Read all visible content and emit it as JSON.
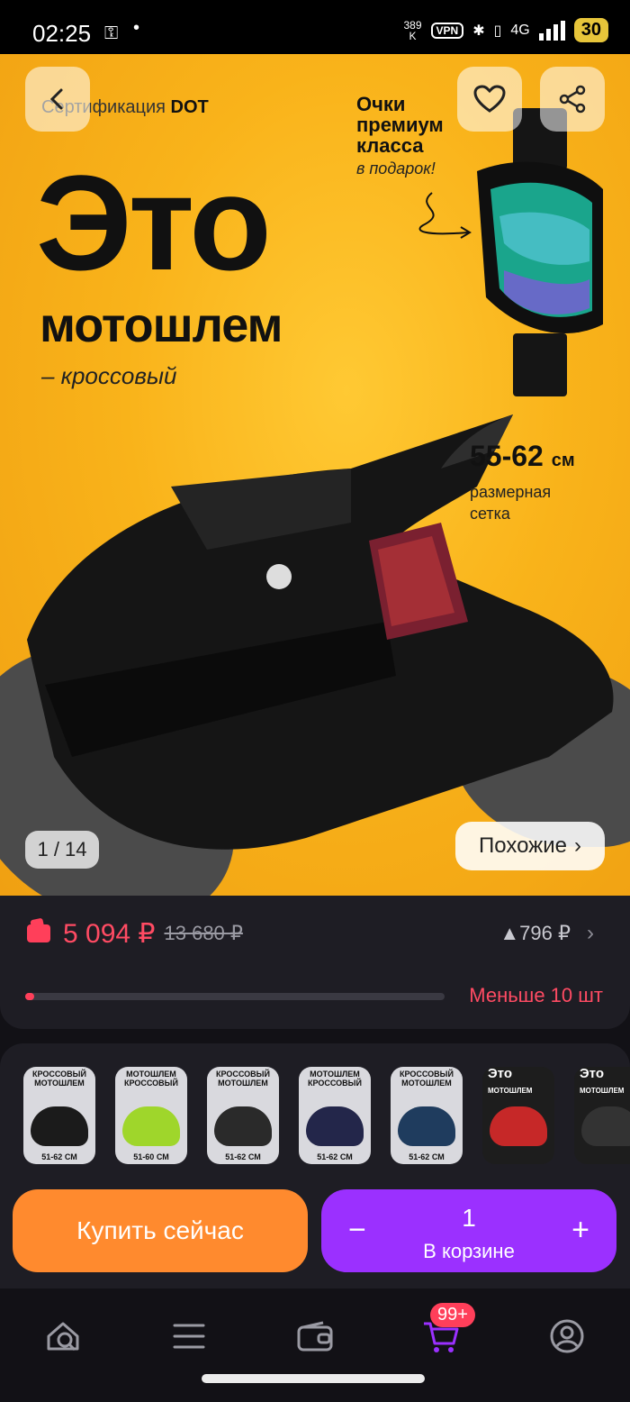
{
  "status_bar": {
    "time": "02:25",
    "speed_value": "389",
    "speed_unit": "K",
    "vpn": "VPN",
    "network": "4G",
    "battery": "30"
  },
  "hero": {
    "certification_prefix": "Сертификация",
    "certification_brand": "DOT",
    "headline_big": "Это",
    "headline_sub": "мотошлем",
    "headline_type": "– кроссовый",
    "goggles_title_1": "Очки",
    "goggles_title_2": "премиум",
    "goggles_title_3": "класса",
    "goggles_subtitle": "в подарок!",
    "size_value": "55-62",
    "size_unit": "см",
    "size_label": "размерная сетка",
    "image_counter": "1 / 14",
    "similar_button": "Похожие",
    "similar_chevron": "›"
  },
  "price": {
    "current": "5 094 ₽",
    "old": "13 680 ₽",
    "price_rise": "▲796 ₽",
    "chevron": "›",
    "stock_label": "Меньше 10 шт",
    "stock_fraction": 0.02
  },
  "variants": [
    {
      "title": "КРОССОВЫЙ МОТОШЛЕМ",
      "size": "51-62 СМ",
      "color": "#1b1b1b"
    },
    {
      "title": "МОТОШЛЕМ КРОССОВЫЙ",
      "size": "51-60 СМ",
      "color": "#9fd62b"
    },
    {
      "title": "КРОССОВЫЙ МОТОШЛЕМ",
      "size": "51-62 СМ",
      "color": "#2a2a2a"
    },
    {
      "title": "МОТОШЛЕМ КРОССОВЫЙ",
      "size": "51-62 СМ",
      "color": "#23264a"
    },
    {
      "title": "КРОССОВЫЙ МОТОШЛЕМ",
      "size": "51-62 СМ",
      "color": "#1f3c5e"
    },
    {
      "title": "Это",
      "size": "МОТОШЛЕМ",
      "color": "#c62828"
    },
    {
      "title": "Это",
      "size": "МОТОШЛЕМ",
      "color": "#333333"
    }
  ],
  "actions": {
    "buy_now": "Купить сейчас",
    "minus": "−",
    "plus": "+",
    "quantity": "1",
    "in_cart": "В корзине"
  },
  "nav": {
    "cart_badge": "99+"
  },
  "colors": {
    "accent_red": "#ff3f5a",
    "buy_orange": "#ff8a2e",
    "cart_purple": "#9b30ff",
    "hero_yellow": "#f9b31a"
  }
}
